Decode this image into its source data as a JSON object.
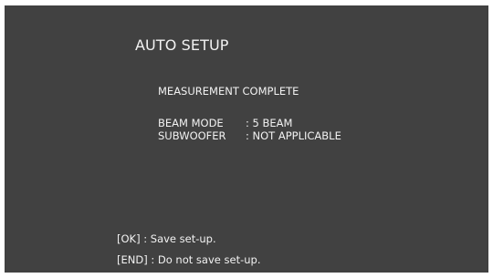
{
  "screen": {
    "title": "AUTO SETUP",
    "status": "MEASUREMENT COMPLETE",
    "info": [
      {
        "label": "BEAM MODE",
        "value": ": 5 BEAM"
      },
      {
        "label": "SUBWOOFER",
        "value": ": NOT APPLICABLE"
      }
    ],
    "actions": [
      {
        "key": "[OK]",
        "sep": " : ",
        "text": "Save set-up."
      },
      {
        "key": "[END]",
        "sep": " : ",
        "text": " Do not save set-up."
      }
    ]
  },
  "colors": {
    "background": "#414141",
    "text": "#f2f2f2"
  }
}
